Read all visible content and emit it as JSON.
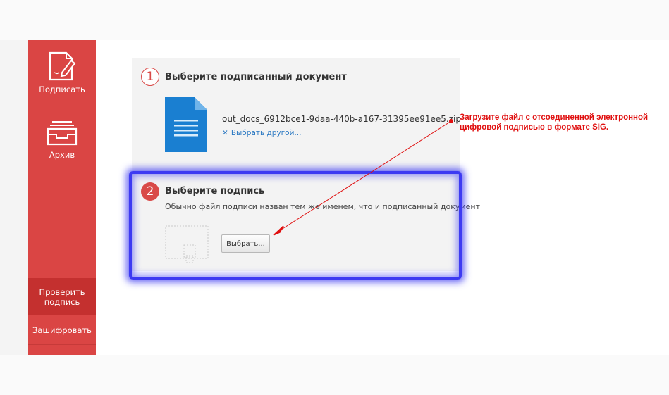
{
  "sidebar": {
    "sign_label": "Подписать",
    "archive_label": "Архив",
    "verify_label": "Проверить подпись",
    "encrypt_label": "Зашифровать"
  },
  "step1": {
    "number": "1",
    "title": "Выберите подписанный документ",
    "file_name": "out_docs_6912bce1-9daa-440b-a167-31395ee91ee5.zip",
    "choose_other": "Выбрать другой...",
    "choose_other_icon": "close-icon"
  },
  "step2": {
    "number": "2",
    "title": "Выберите подпись",
    "hint": "Обычно файл подписи назван тем же именем, что и подписанный документ",
    "choose_button": "Выбрать..."
  },
  "annotation": {
    "text": "Загрузите файл с отсоединенной электронной цифровой подписью в формате SIG.",
    "color": "#e01010"
  },
  "colors": {
    "sidebar": "#da4544",
    "sidebar_active": "#c4302f",
    "accent": "#d94a48",
    "link": "#2a78c2",
    "doc_icon": "#1a7fd1",
    "highlight": "#3d3af2"
  }
}
